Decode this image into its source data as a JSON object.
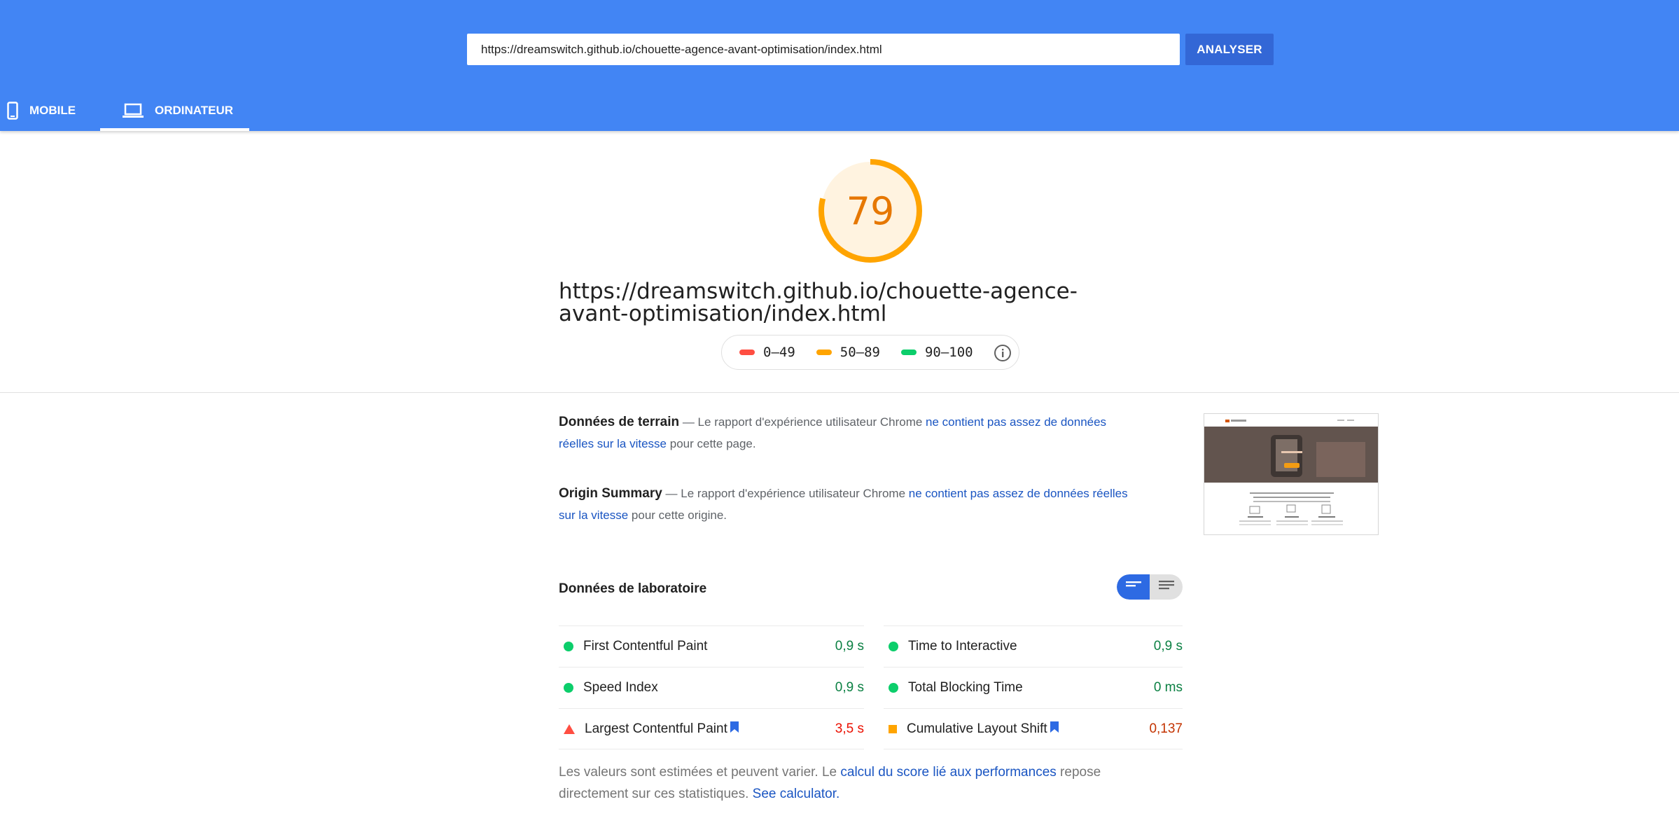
{
  "search": {
    "url_value": "https://dreamswitch.github.io/chouette-agence-avant-optimisation/index.html",
    "analyze_label": "ANALYSER"
  },
  "tabs": [
    {
      "label": "MOBILE",
      "icon": "phone-icon",
      "active": false
    },
    {
      "label": "ORDINATEUR",
      "icon": "laptop-icon",
      "active": true
    }
  ],
  "score": {
    "value": "79",
    "fraction": 0.79,
    "color": "#ffa400",
    "fill": "#fff3e0"
  },
  "page_url": "https://dreamswitch.github.io/chouette-agence-avant-optimisation/index.html",
  "legend": [
    {
      "label": "0–49",
      "color": "#ff4e42"
    },
    {
      "label": "50–89",
      "color": "#ffa400"
    },
    {
      "label": "90–100",
      "color": "#0cce6b"
    }
  ],
  "field_data": {
    "title": "Données de terrain",
    "prefix": " — Le rapport d'expérience utilisateur Chrome ",
    "link": "ne contient pas assez de données réelles sur la vitesse",
    "suffix": " pour cette page."
  },
  "origin_summary": {
    "title": "Origin Summary",
    "prefix": " — Le rapport d'expérience utilisateur Chrome ",
    "link": "ne contient pas assez de données réelles sur la vitesse",
    "suffix": " pour cette origine."
  },
  "lab": {
    "title": "Données de laboratoire",
    "metrics_left": [
      {
        "label": "First Contentful Paint",
        "value": "0,9 s",
        "status": "good",
        "bookmark": false
      },
      {
        "label": "Speed Index",
        "value": "0,9 s",
        "status": "good",
        "bookmark": false
      },
      {
        "label": "Largest Contentful Paint",
        "value": "3,5 s",
        "status": "bad",
        "bookmark": true
      }
    ],
    "metrics_right": [
      {
        "label": "Time to Interactive",
        "value": "0,9 s",
        "status": "good",
        "bookmark": false
      },
      {
        "label": "Total Blocking Time",
        "value": "0 ms",
        "status": "good",
        "bookmark": false
      },
      {
        "label": "Cumulative Layout Shift",
        "value": "0,137",
        "status": "avg",
        "bookmark": true
      }
    ]
  },
  "footnote": {
    "prefix": "Les valeurs sont estimées et peuvent varier. Le ",
    "link1": "calcul du score lié aux performances",
    "middle": " repose directement sur ces statistiques. ",
    "link2": "See calculator."
  }
}
